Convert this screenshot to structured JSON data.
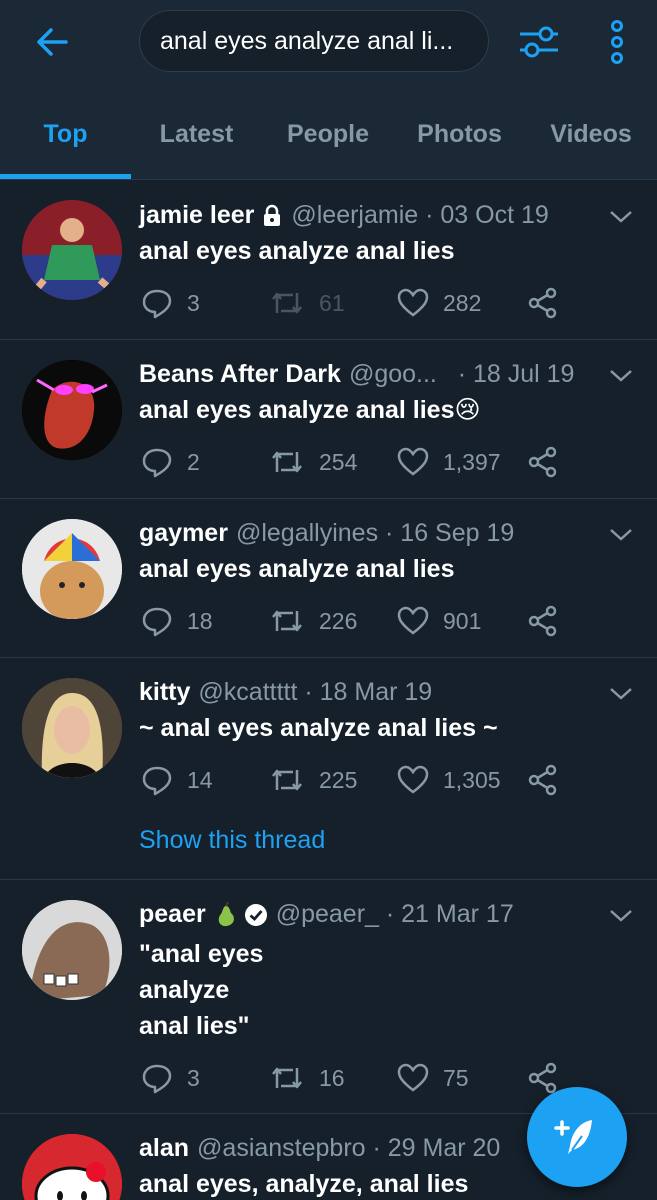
{
  "search": {
    "query": "anal eyes analyze anal li..."
  },
  "tabs": [
    {
      "label": "Top"
    },
    {
      "label": "Latest"
    },
    {
      "label": "People"
    },
    {
      "label": "Photos"
    },
    {
      "label": "Videos"
    }
  ],
  "active_tab": "Top",
  "tweets": [
    {
      "name": "jamie leer",
      "handle": "@leerjamie · 03 Oct 19",
      "text": "anal eyes analyze anal lies",
      "replies": "3",
      "retweets": "61",
      "likes": "282"
    },
    {
      "name": "Beans After Dark",
      "handle": "@goo...   · 18 Jul 19",
      "text": "anal eyes analyze anal lies😢",
      "replies": "2",
      "retweets": "254",
      "likes": "1,397"
    },
    {
      "name": "gaymer",
      "handle": "@legallyines · 16 Sep 19",
      "text": "anal eyes analyze anal lies",
      "replies": "18",
      "retweets": "226",
      "likes": "901"
    },
    {
      "name": "kitty",
      "handle": "@kcattttt · 18 Mar 19",
      "text": "~ anal eyes analyze anal lies ~",
      "replies": "14",
      "retweets": "225",
      "likes": "1,305",
      "thread_link": "Show this thread"
    },
    {
      "name": "peaer",
      "handle": "@peaer_ · 21 Mar 17",
      "text": "\"anal eyes\nanalyze\nanal lies\"",
      "replies": "3",
      "retweets": "16",
      "likes": "75"
    },
    {
      "name": "alan",
      "handle": "@asianstepbro · 29 Mar 20",
      "text": "anal eyes, analyze, anal lies"
    }
  ],
  "colors": {
    "background": "#15202b",
    "accent": "#1da1f2",
    "muted": "#8899a6"
  }
}
